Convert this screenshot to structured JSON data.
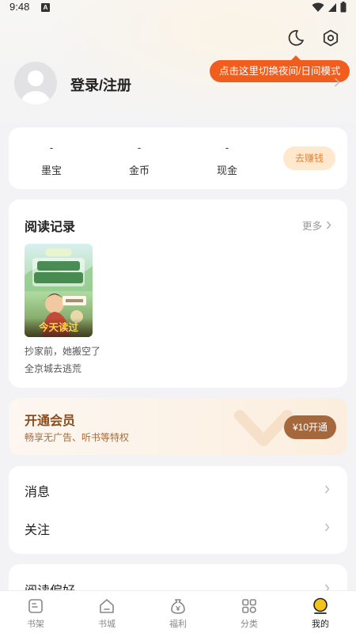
{
  "status_bar": {
    "time": "9:48",
    "notif_icon": "a-icon"
  },
  "tooltip": "点击这里切换夜间/日间模式",
  "profile": {
    "login_label": "登录/注册"
  },
  "wallet": {
    "items": [
      {
        "value": "-",
        "label": "墨宝"
      },
      {
        "value": "-",
        "label": "金币"
      },
      {
        "value": "-",
        "label": "现金"
      }
    ],
    "earn_button": "去赚钱"
  },
  "reading_history": {
    "title": "阅读记录",
    "more": "更多",
    "book": {
      "cover_title": "她搬空了全京城去逃荒",
      "badge": "今天读过",
      "name": "抄家前，她搬空了全京城去逃荒"
    }
  },
  "vip": {
    "title": "开通会员",
    "subtitle": "畅享无广告、听书等特权",
    "button": "¥10开通"
  },
  "menu": {
    "items": [
      {
        "label": "消息"
      },
      {
        "label": "关注"
      }
    ]
  },
  "preferences": {
    "label": "阅读偏好"
  },
  "tabbar": {
    "items": [
      {
        "label": "书架",
        "icon": "bookshelf-icon"
      },
      {
        "label": "书城",
        "icon": "bookstore-icon"
      },
      {
        "label": "福利",
        "icon": "welfare-icon"
      },
      {
        "label": "分类",
        "icon": "category-icon"
      },
      {
        "label": "我的",
        "icon": "profile-icon",
        "active": true
      }
    ]
  },
  "colors": {
    "accent": "#f05d1c",
    "vip_brown": "#a5683d",
    "earn_bg": "#ffe8ce",
    "earn_text": "#e9832a"
  }
}
